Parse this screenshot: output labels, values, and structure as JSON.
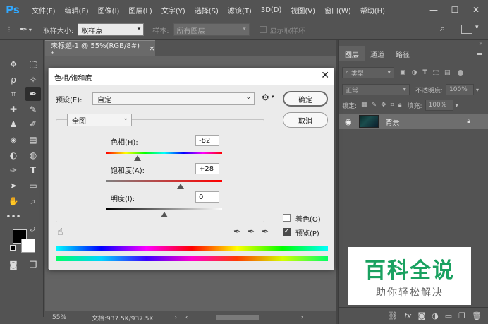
{
  "app": {
    "logo": "Ps",
    "menu": [
      "文件(F)",
      "编辑(E)",
      "图像(I)",
      "图层(L)",
      "文字(Y)",
      "选择(S)",
      "滤镜(T)",
      "3D(D)",
      "视图(V)",
      "窗口(W)",
      "帮助(H)"
    ],
    "window_controls": {
      "minimize": "—",
      "maximize": "☐",
      "close": "✕"
    }
  },
  "options_bar": {
    "sample_size_label": "取样大小:",
    "sample_size_value": "取样点",
    "sample_label": "样本:",
    "sample_value": "所有图层",
    "show_ring_label": "显示取样环"
  },
  "document": {
    "tab_title": "未标题-1 @ 55%(RGB/8#) *",
    "tab_close": "×",
    "zoom": "55%",
    "doc_info": "文档:937.5K/937.5K"
  },
  "dialog": {
    "title": "色相/饱和度",
    "preset_label": "预设(E):",
    "preset_value": "自定",
    "ok_label": "确定",
    "cancel_label": "取消",
    "channel_value": "全图",
    "hue_label": "色相(H):",
    "hue_value": "-82",
    "hue_position": 0.27,
    "saturation_label": "饱和度(A):",
    "saturation_value": "+28",
    "saturation_position": 0.64,
    "lightness_label": "明度(I):",
    "lightness_value": "0",
    "lightness_position": 0.5,
    "colorize_label": "着色(O)",
    "colorize_checked": false,
    "preview_label": "预览(P)",
    "preview_checked": true
  },
  "panels": {
    "tabs": [
      "图层",
      "通道",
      "路径"
    ],
    "filter_kind": "类型",
    "blend_mode": "正常",
    "opacity_label": "不透明度:",
    "opacity_value": "100%",
    "lock_label": "锁定:",
    "fill_label": "填充:",
    "fill_value": "100%",
    "layer_name": "背景"
  },
  "watermark": {
    "main": "百科全说",
    "sub": "助你轻松解决"
  },
  "colors": {
    "accent": "#31a8ff",
    "watermark_green": "#1aa160"
  }
}
